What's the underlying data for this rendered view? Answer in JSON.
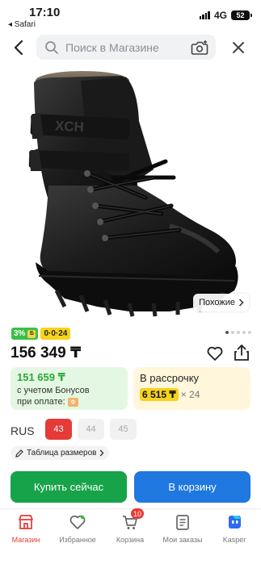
{
  "status_bar": {
    "time": "17:10",
    "back_app": "◂ Safari",
    "network": "4G",
    "battery": "52"
  },
  "search": {
    "placeholder": "Поиск в Магазине"
  },
  "product": {
    "brand_text_on_image": "XCH",
    "similar_label": "Похожие",
    "cashback_badge": "3%",
    "cashback_badge_icon": "Б",
    "installment_badge": "0·0·24",
    "price": "156 349 ₸",
    "image_pages": 5,
    "active_image_index": 0
  },
  "bonus_card": {
    "amount": "151 659 ₸",
    "line1": "с учетом Бонусов",
    "line2": "при оплате:",
    "chip": "Ф"
  },
  "credit_card": {
    "title": "В рассрочку",
    "monthly": "6 515 ₸",
    "times": "× 24"
  },
  "sizes": {
    "label": "RUS",
    "options": [
      {
        "value": "43",
        "selected": true
      },
      {
        "value": "44",
        "selected": false
      },
      {
        "value": "45",
        "selected": false
      }
    ],
    "table_label": "Таблица размеров"
  },
  "actions": {
    "buy_now": "Купить сейчас",
    "add_to_cart": "В корзину"
  },
  "tab_bar": {
    "items": [
      {
        "label": "Магазин",
        "icon": "shop-icon",
        "active": true
      },
      {
        "label": "Избранное",
        "icon": "heart-icon",
        "active": false
      },
      {
        "label": "Корзина",
        "icon": "cart-icon",
        "active": false,
        "badge": "10"
      },
      {
        "label": "Мои заказы",
        "icon": "orders-icon",
        "active": false
      },
      {
        "label": "Kasper",
        "icon": "kasper-icon",
        "active": false
      }
    ]
  },
  "colors": {
    "accent_red": "#e63a36",
    "buy_green": "#17a34a",
    "cart_blue": "#1e78e0",
    "bonus_green": "#2fa73a",
    "installment_yellow": "#f7d31a"
  }
}
